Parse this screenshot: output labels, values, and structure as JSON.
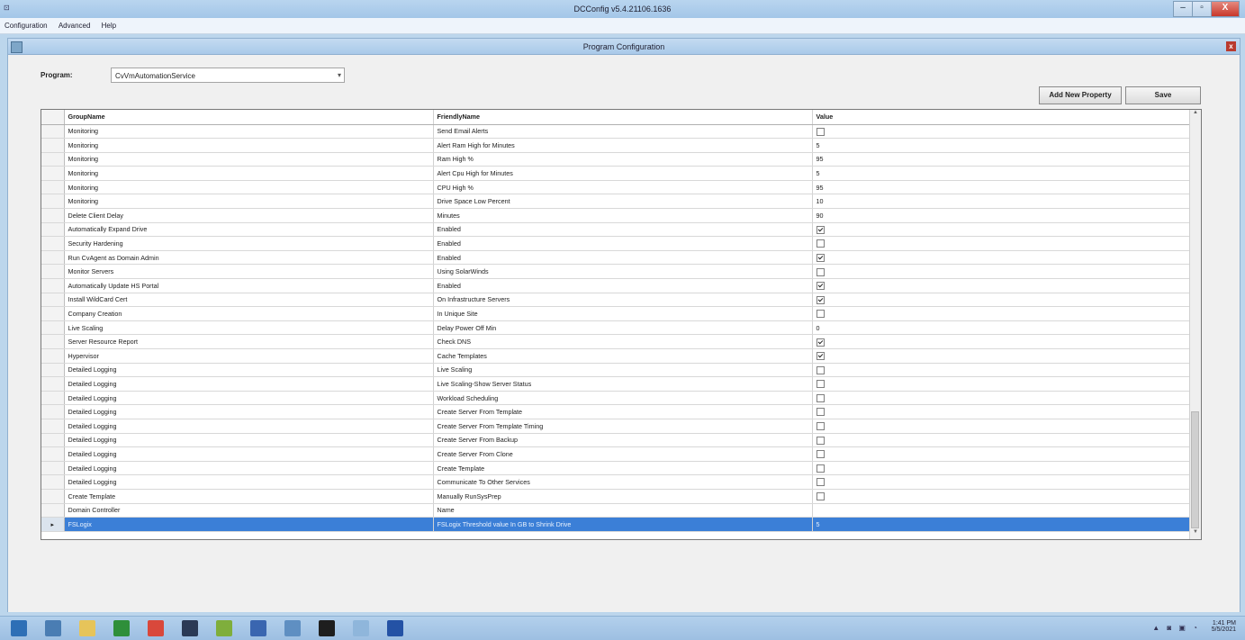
{
  "window": {
    "title": "DCConfig v5.4.21106.1636",
    "min": "–",
    "max": "▫",
    "close": "X"
  },
  "menu": [
    "Configuration",
    "Advanced",
    "Help"
  ],
  "child": {
    "title": "Program Configuration",
    "close": "x"
  },
  "program": {
    "label": "Program:",
    "value": "CvVmAutomationService"
  },
  "buttons": {
    "add": "Add New Property",
    "save": "Save"
  },
  "columns": [
    "GroupName",
    "FriendlyName",
    "Value"
  ],
  "rows": [
    {
      "g": "Monitoring",
      "f": "Send Email Alerts",
      "v": "",
      "cb": true,
      "checked": false
    },
    {
      "g": "Monitoring",
      "f": "Alert Ram High for Minutes",
      "v": "5",
      "cb": false,
      "checked": false
    },
    {
      "g": "Monitoring",
      "f": "Ram High %",
      "v": "95",
      "cb": false,
      "checked": false
    },
    {
      "g": "Monitoring",
      "f": "Alert Cpu High for Minutes",
      "v": "5",
      "cb": false,
      "checked": false
    },
    {
      "g": "Monitoring",
      "f": "CPU High %",
      "v": "95",
      "cb": false,
      "checked": false
    },
    {
      "g": "Monitoring",
      "f": "Drive Space Low Percent",
      "v": "10",
      "cb": false,
      "checked": false
    },
    {
      "g": "Delete Client Delay",
      "f": "Minutes",
      "v": "90",
      "cb": false,
      "checked": false
    },
    {
      "g": "Automatically Expand Drive",
      "f": "Enabled",
      "v": "",
      "cb": true,
      "checked": true
    },
    {
      "g": "Security Hardening",
      "f": "Enabled",
      "v": "",
      "cb": true,
      "checked": false
    },
    {
      "g": "Run CvAgent as Domain Admin",
      "f": "Enabled",
      "v": "",
      "cb": true,
      "checked": true
    },
    {
      "g": "Monitor Servers",
      "f": "Using SolarWinds",
      "v": "",
      "cb": true,
      "checked": false
    },
    {
      "g": "Automatically Update HS Portal",
      "f": "Enabled",
      "v": "",
      "cb": true,
      "checked": true
    },
    {
      "g": "Install WildCard Cert",
      "f": "On Infrastructure Servers",
      "v": "",
      "cb": true,
      "checked": true
    },
    {
      "g": "Company Creation",
      "f": "In Unique Site",
      "v": "",
      "cb": true,
      "checked": false
    },
    {
      "g": "Live Scaling",
      "f": "Delay Power Off Min",
      "v": "0",
      "cb": false,
      "checked": false
    },
    {
      "g": "Server Resource Report",
      "f": "Check DNS",
      "v": "",
      "cb": true,
      "checked": true
    },
    {
      "g": "Hypervisor",
      "f": "Cache Templates",
      "v": "",
      "cb": true,
      "checked": true
    },
    {
      "g": "Detailed Logging",
      "f": "Live Scaling",
      "v": "",
      "cb": true,
      "checked": false
    },
    {
      "g": "Detailed Logging",
      "f": "Live Scaling-Show Server Status",
      "v": "",
      "cb": true,
      "checked": false
    },
    {
      "g": "Detailed Logging",
      "f": "Workload Scheduling",
      "v": "",
      "cb": true,
      "checked": false
    },
    {
      "g": "Detailed Logging",
      "f": "Create Server From Template",
      "v": "",
      "cb": true,
      "checked": false
    },
    {
      "g": "Detailed Logging",
      "f": "Create Server From Template Timing",
      "v": "",
      "cb": true,
      "checked": false
    },
    {
      "g": "Detailed Logging",
      "f": "Create Server From Backup",
      "v": "",
      "cb": true,
      "checked": false
    },
    {
      "g": "Detailed Logging",
      "f": "Create Server From Clone",
      "v": "",
      "cb": true,
      "checked": false
    },
    {
      "g": "Detailed Logging",
      "f": "Create Template",
      "v": "",
      "cb": true,
      "checked": false
    },
    {
      "g": "Detailed Logging",
      "f": "Communicate To Other Services",
      "v": "",
      "cb": true,
      "checked": false
    },
    {
      "g": "Create Template",
      "f": "Manually RunSysPrep",
      "v": "",
      "cb": true,
      "checked": false
    },
    {
      "g": "Domain Controller",
      "f": "Name",
      "v": "",
      "cb": false,
      "checked": false
    },
    {
      "g": "FSLogix",
      "f": "FSLogix Threshold value In GB to Shrink Drive",
      "v": "5",
      "cb": false,
      "checked": false,
      "selected": true
    }
  ],
  "taskbar": {
    "items": [
      {
        "name": "windows-start-icon",
        "color": "#2e6fb6"
      },
      {
        "name": "server-manager-icon",
        "color": "#4a7db3"
      },
      {
        "name": "file-explorer-icon",
        "color": "#e6c45a"
      },
      {
        "name": "green-app-icon",
        "color": "#2f8f3a"
      },
      {
        "name": "chrome-icon",
        "color": "#d9483b"
      },
      {
        "name": "dark-app-icon",
        "color": "#2b3a55"
      },
      {
        "name": "notepad-app-icon",
        "color": "#7fae3c"
      },
      {
        "name": "users-app-icon",
        "color": "#3a66b0"
      },
      {
        "name": "config-app-icon",
        "color": "#5f8fc2"
      },
      {
        "name": "terminal-icon",
        "color": "#1e1e1e"
      },
      {
        "name": "search-app-icon",
        "color": "#8fb6db"
      },
      {
        "name": "blue-app-icon",
        "color": "#2452a5"
      }
    ],
    "tray_icons": "▲ ◙ ▣ ◔",
    "time": "1:41 PM",
    "date": "5/5/2021"
  }
}
